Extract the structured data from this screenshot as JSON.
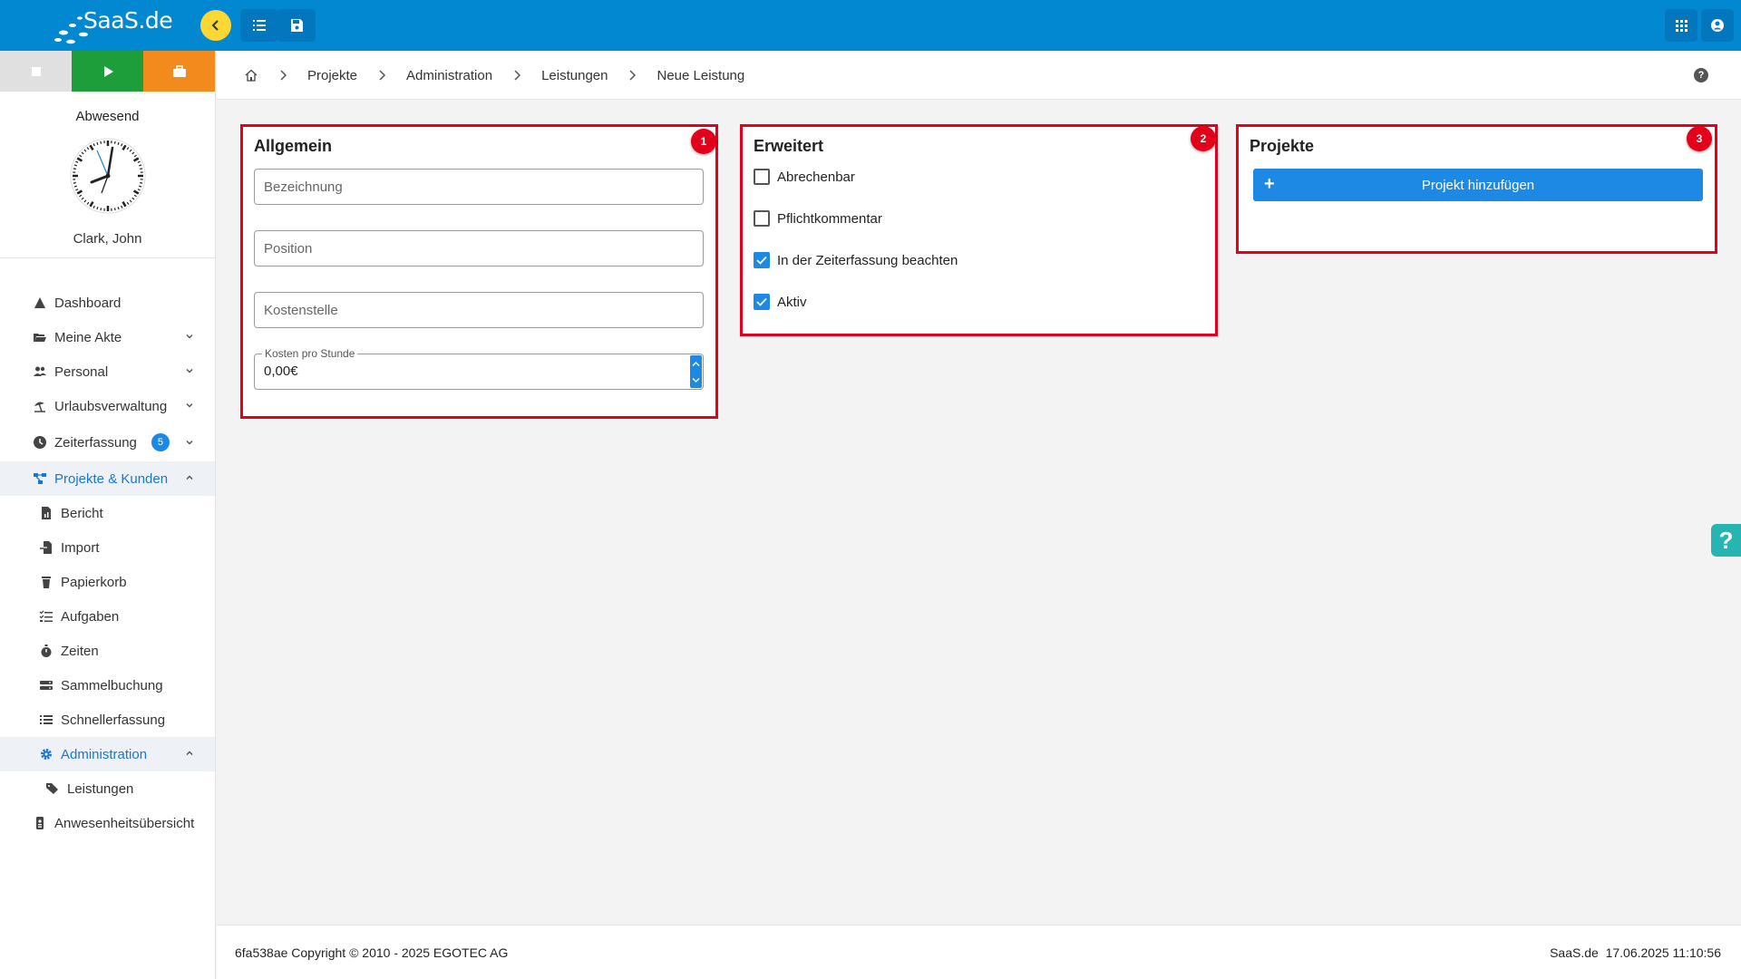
{
  "app": {
    "brand": "SaaS.de"
  },
  "sidebar": {
    "status": "Abwesend",
    "user": "Clark, John",
    "items": [
      {
        "label": "Dashboard"
      },
      {
        "label": "Meine Akte"
      },
      {
        "label": "Personal"
      },
      {
        "label": "Urlaubsverwaltung"
      },
      {
        "label": "Zeiterfassung",
        "badge": "5"
      },
      {
        "label": "Projekte & Kunden"
      },
      {
        "label": "Bericht"
      },
      {
        "label": "Import"
      },
      {
        "label": "Papierkorb"
      },
      {
        "label": "Aufgaben"
      },
      {
        "label": "Zeiten"
      },
      {
        "label": "Sammelbuchung"
      },
      {
        "label": "Schnellerfassung"
      },
      {
        "label": "Administration"
      },
      {
        "label": "Leistungen"
      },
      {
        "label": "Anwesenheitsübersicht"
      }
    ]
  },
  "breadcrumb": [
    "Projekte",
    "Administration",
    "Leistungen",
    "Neue Leistung"
  ],
  "cards": {
    "general": {
      "title": "Allgemein",
      "marker": "1",
      "fields": {
        "name_placeholder": "Bezeichnung",
        "position_placeholder": "Position",
        "cost_center_placeholder": "Kostenstelle",
        "cost_label": "Kosten pro Stunde",
        "cost_value": "0,00€"
      }
    },
    "extended": {
      "title": "Erweitert",
      "marker": "2",
      "checkboxes": [
        {
          "label": "Abrechenbar",
          "checked": false
        },
        {
          "label": "Pflichtkommentar",
          "checked": false
        },
        {
          "label": "In der Zeiterfassung beachten",
          "checked": true
        },
        {
          "label": "Aktiv",
          "checked": true
        }
      ]
    },
    "projects": {
      "title": "Projekte",
      "marker": "3",
      "add_button": "Projekt hinzufügen"
    }
  },
  "footer": {
    "left": "6fa538ae Copyright © 2010 - 2025 EGOTEC AG",
    "right": "SaaS.de  17.06.2025 11:10:56"
  },
  "colors": {
    "primary": "#0288d1",
    "accent": "#1e88e5",
    "marker": "#e2001a",
    "play": "#1e9e3a",
    "pause": "#f28a1e"
  }
}
